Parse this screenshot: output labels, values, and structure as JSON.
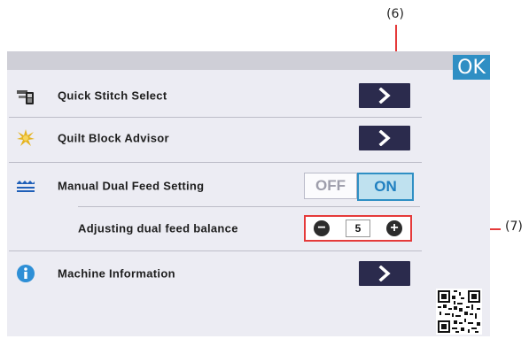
{
  "callouts": {
    "c6": "(6)",
    "c7": "(7)"
  },
  "header": {
    "ok_label": "OK"
  },
  "menu": {
    "quick_stitch": {
      "label": "Quick Stitch Select",
      "icon": "phone-sewing-icon",
      "arrow": "chevron-right-icon"
    },
    "quilt_block": {
      "label": "Quilt Block Advisor",
      "icon": "star-burst-icon",
      "arrow": "chevron-right-icon"
    },
    "dual_feed": {
      "label": "Manual Dual Feed Setting",
      "icon": "dual-feed-icon",
      "off_label": "OFF",
      "on_label": "ON",
      "selected": "ON"
    },
    "dual_feed_balance": {
      "label": "Adjusting dual feed balance",
      "value": "5",
      "minus": "−",
      "plus": "+"
    },
    "machine_info": {
      "label": "Machine Information",
      "icon": "info-icon",
      "arrow": "chevron-right-icon"
    }
  },
  "colors": {
    "accent_blue": "#2f8fc4",
    "button_dark": "#2b2b4d",
    "callout_red": "#e53a3a",
    "screen_bg": "#ececf3"
  }
}
